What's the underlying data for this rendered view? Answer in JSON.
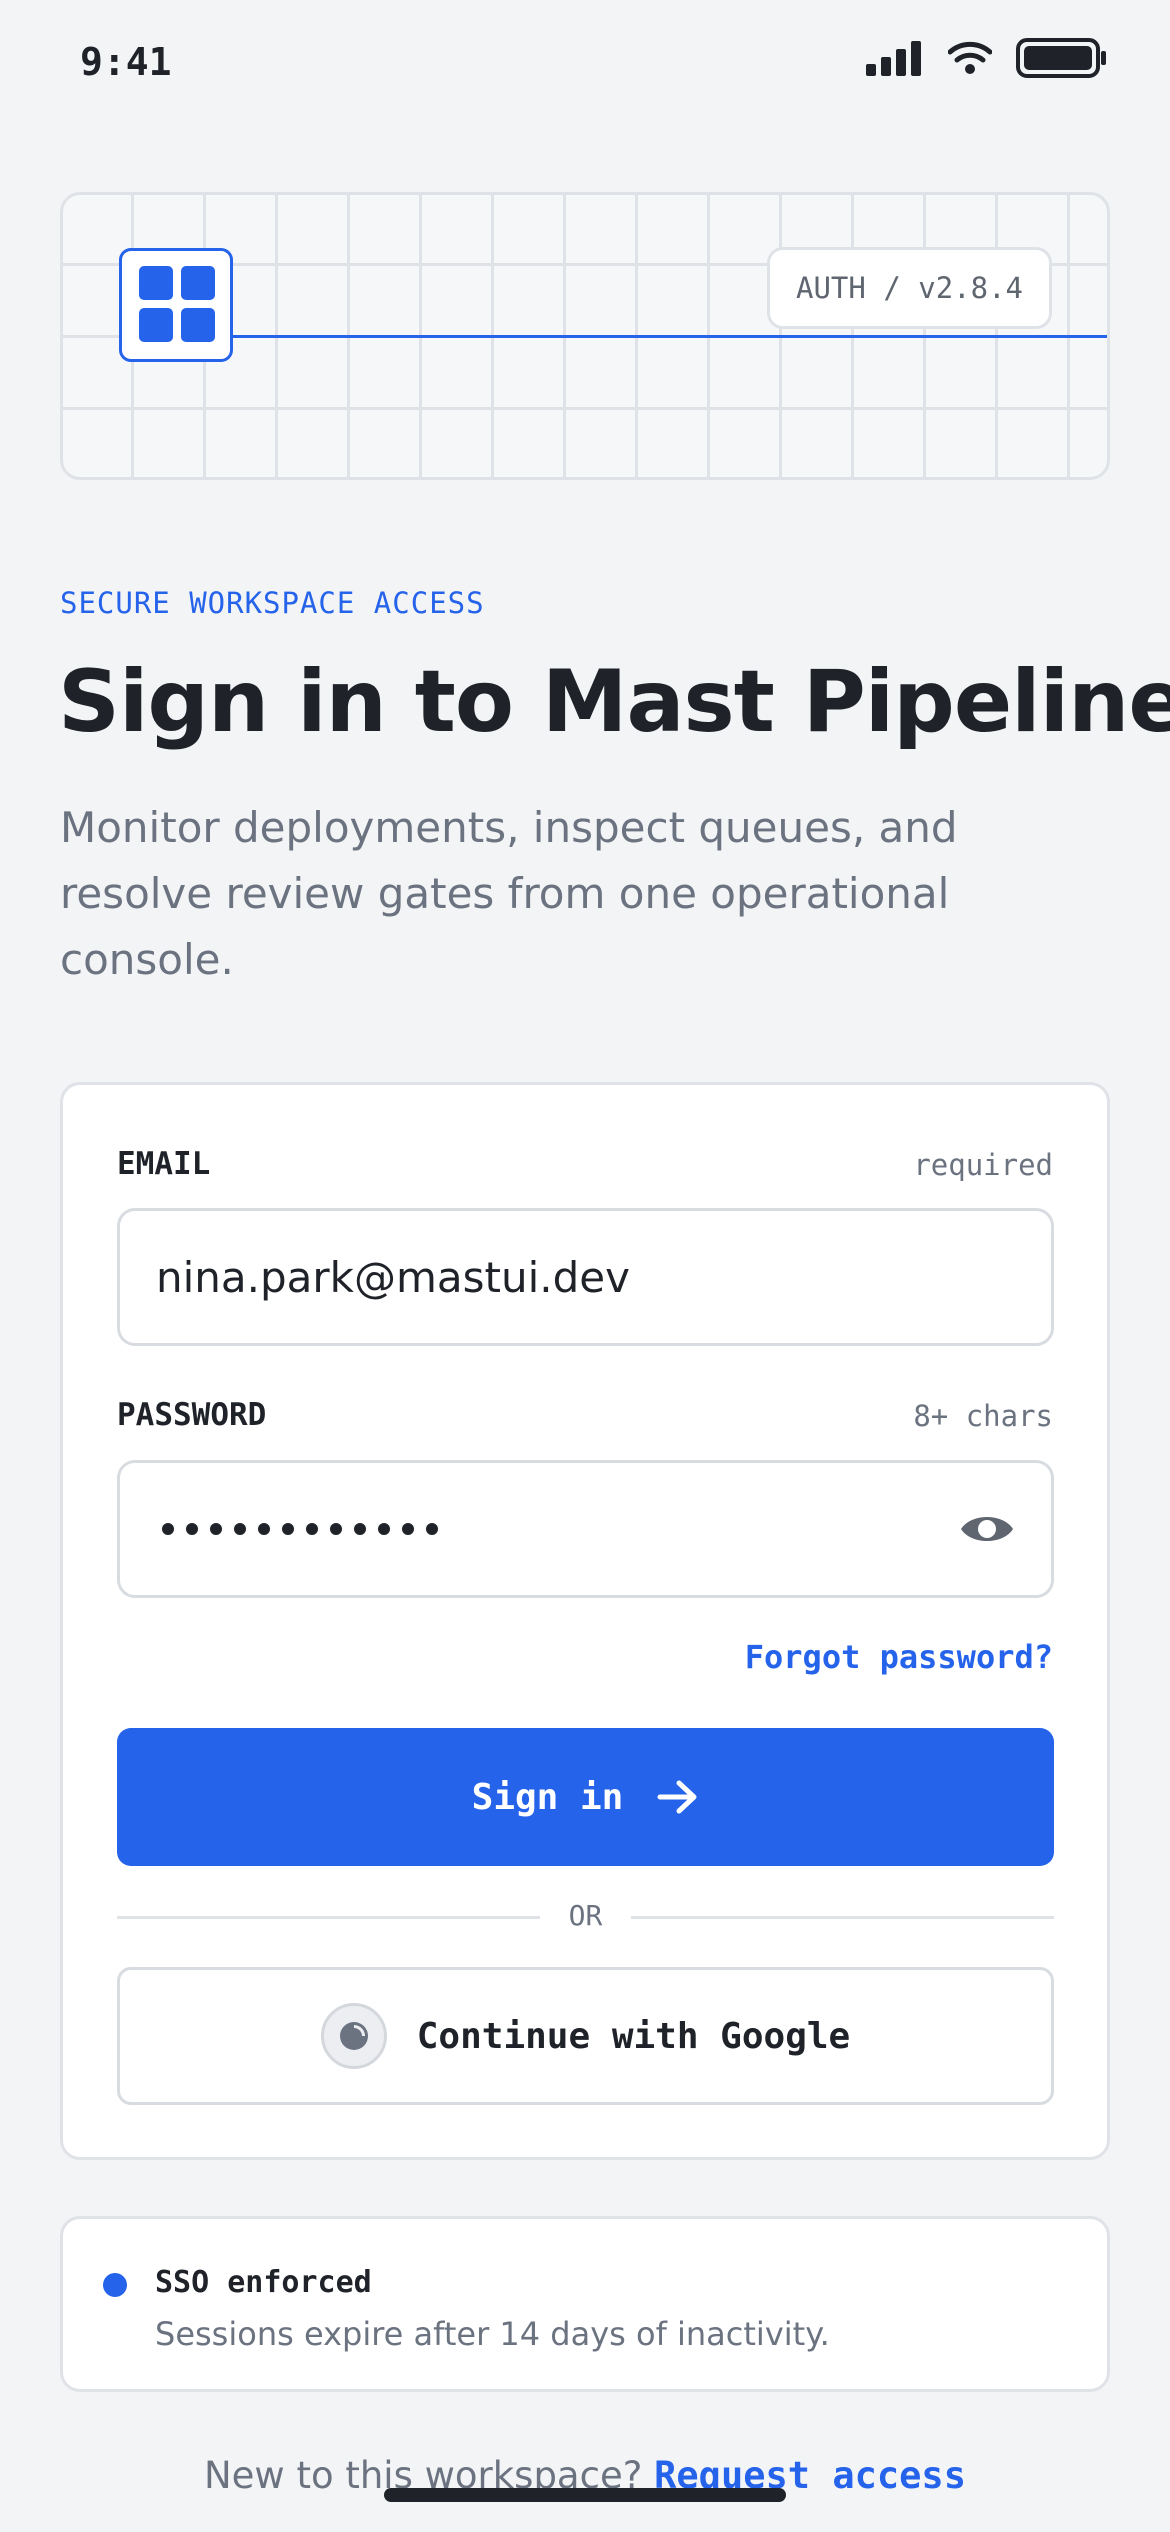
{
  "status_bar": {
    "time": "9:41",
    "icons": [
      "signal-icon",
      "wifi-icon",
      "battery-icon"
    ]
  },
  "banner": {
    "logo_icon": "grid-logo-icon",
    "version": "AUTH / v2.8.4"
  },
  "intro": {
    "eyebrow": "SECURE WORKSPACE ACCESS",
    "title": "Sign in to Mast Pipeline",
    "subtitle": "Monitor deployments, inspect queues, and resolve review gates from one operational console."
  },
  "form": {
    "email": {
      "label": "EMAIL",
      "hint": "required",
      "value": "nina.park@mastui.dev"
    },
    "password": {
      "label": "PASSWORD",
      "hint": "8+ chars",
      "masked_length": 12,
      "toggle_icon": "eye-icon"
    },
    "forgot_label": "Forgot password?",
    "submit_label": "Sign in",
    "submit_icon": "arrow-right-icon",
    "divider_label": "OR",
    "google_label": "Continue with Google",
    "google_icon": "google-icon"
  },
  "sso": {
    "title": "SSO enforced",
    "description": "Sessions expire after 14 days of inactivity."
  },
  "footer": {
    "prompt": "New to this workspace?",
    "link_label": "Request access"
  },
  "colors": {
    "accent": "#2563eb",
    "background": "#f3f4f6",
    "text": "#1f2329",
    "muted": "#6b7280"
  }
}
